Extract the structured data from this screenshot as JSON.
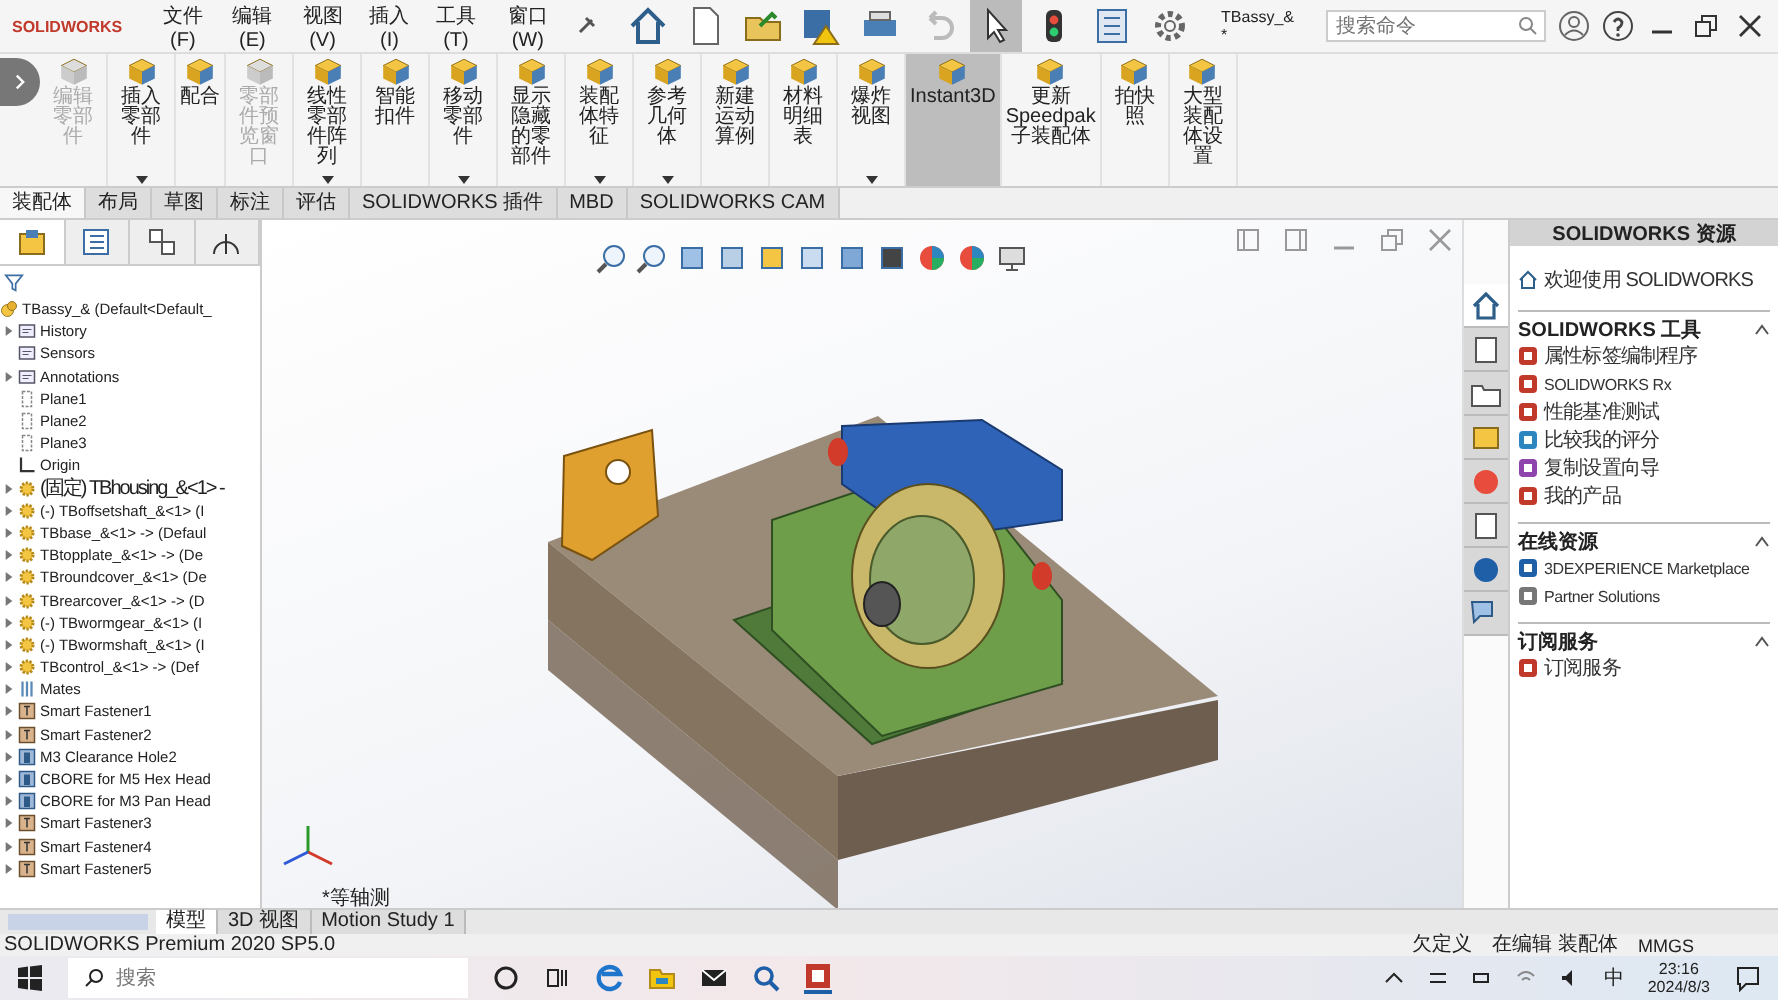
{
  "title_bar": {
    "logo": "SOLIDWORKS",
    "menus": [
      "文件(F)",
      "编辑(E)",
      "视图(V)",
      "插入(I)",
      "工具(T)",
      "窗口(W)"
    ],
    "document": "TBassy_& *",
    "search": {
      "placeholder": "搜索命令"
    }
  },
  "command_manager": {
    "buttons": [
      {
        "label": "编辑零部件",
        "disabled": true,
        "selected": false,
        "dropdown": false
      },
      {
        "label": "插入零部件",
        "disabled": false,
        "selected": false,
        "dropdown": true
      },
      {
        "label": "配合",
        "disabled": false,
        "selected": false,
        "dropdown": false
      },
      {
        "label": "零部件预览窗口",
        "disabled": true,
        "selected": false,
        "dropdown": false
      },
      {
        "label": "线性零部件阵列",
        "disabled": false,
        "selected": false,
        "dropdown": true
      },
      {
        "label": "智能扣件",
        "disabled": false,
        "selected": false,
        "dropdown": false
      },
      {
        "label": "移动零部件",
        "disabled": false,
        "selected": false,
        "dropdown": true
      },
      {
        "label": "显示隐藏的零部件",
        "disabled": false,
        "selected": false,
        "dropdown": false
      },
      {
        "label": "装配体特征",
        "disabled": false,
        "selected": false,
        "dropdown": true
      },
      {
        "label": "参考几何体",
        "disabled": false,
        "selected": false,
        "dropdown": true
      },
      {
        "label": "新建运动算例",
        "disabled": false,
        "selected": false,
        "dropdown": false
      },
      {
        "label": "材料明细表",
        "disabled": false,
        "selected": false,
        "dropdown": false
      },
      {
        "label": "爆炸视图",
        "disabled": false,
        "selected": false,
        "dropdown": true
      },
      {
        "label": "Instant3D",
        "disabled": false,
        "selected": true,
        "dropdown": false
      },
      {
        "label": "更新 Speedpak 子装配体",
        "disabled": false,
        "selected": false,
        "dropdown": false
      },
      {
        "label": "拍快照",
        "disabled": false,
        "selected": false,
        "dropdown": false
      },
      {
        "label": "大型装配体设置",
        "disabled": false,
        "selected": false,
        "dropdown": false
      }
    ]
  },
  "tabs": [
    {
      "label": "装配体",
      "selected": true
    },
    {
      "label": "布局",
      "selected": false
    },
    {
      "label": "草图",
      "selected": false
    },
    {
      "label": "标注",
      "selected": false
    },
    {
      "label": "评估",
      "selected": false
    },
    {
      "label": "SOLIDWORKS 插件",
      "selected": false
    },
    {
      "label": "MBD",
      "selected": false
    },
    {
      "label": "SOLIDWORKS CAM",
      "selected": false
    }
  ],
  "feature_tree": {
    "panel_tabs": [
      {
        "selected": true
      },
      {
        "selected": false
      },
      {
        "selected": false
      },
      {
        "selected": false
      }
    ],
    "root": "TBassy_&  (Default<Default_",
    "items": [
      {
        "label": "History",
        "kind": "folder",
        "expandable": true
      },
      {
        "label": "Sensors",
        "kind": "folder",
        "expandable": false
      },
      {
        "label": "Annotations",
        "kind": "folder",
        "expandable": true
      },
      {
        "label": "Plane1",
        "kind": "plane",
        "expandable": false
      },
      {
        "label": "Plane2",
        "kind": "plane",
        "expandable": false
      },
      {
        "label": "Plane3",
        "kind": "plane",
        "expandable": false
      },
      {
        "label": "Origin",
        "kind": "origin",
        "expandable": false
      },
      {
        "label": "(固定) TBhousing_&<1> -",
        "kind": "part",
        "expandable": true
      },
      {
        "label": "(-) TBoffsetshaft_&<1> (I",
        "kind": "part",
        "expandable": true
      },
      {
        "label": "TBbase_&<1> -> (Defaul",
        "kind": "part",
        "expandable": true
      },
      {
        "label": "TBtopplate_&<1> -> (De",
        "kind": "part",
        "expandable": true
      },
      {
        "label": "TBroundcover_&<1> (De",
        "kind": "part",
        "expandable": true
      },
      {
        "label": "TBrearcover_&<1> -> (D",
        "kind": "part",
        "expandable": true
      },
      {
        "label": "(-) TBwormgear_&<1> (I",
        "kind": "part",
        "expandable": true
      },
      {
        "label": "(-) TBwormshaft_&<1> (I",
        "kind": "part",
        "expandable": true
      },
      {
        "label": "TBcontrol_&<1> -> (Def",
        "kind": "part",
        "expandable": true
      },
      {
        "label": "Mates",
        "kind": "mates",
        "expandable": true
      },
      {
        "label": "Smart Fastener1",
        "kind": "fastener",
        "expandable": true
      },
      {
        "label": "Smart Fastener2",
        "kind": "fastener",
        "expandable": true
      },
      {
        "label": "M3 Clearance Hole2",
        "kind": "hole",
        "expandable": true
      },
      {
        "label": "CBORE for M5 Hex Head",
        "kind": "hole",
        "expandable": true
      },
      {
        "label": "CBORE for M3 Pan Head",
        "kind": "hole",
        "expandable": true
      },
      {
        "label": "Smart Fastener3",
        "kind": "fastener",
        "expandable": true
      },
      {
        "label": "Smart Fastener4",
        "kind": "fastener",
        "expandable": true
      },
      {
        "label": "Smart Fastener5",
        "kind": "fastener",
        "expandable": true
      }
    ]
  },
  "viewport": {
    "view_label": "*等轴测"
  },
  "task_pane": {
    "title": "SOLIDWORKS 资源",
    "side_tabs": [
      {
        "selected": true
      },
      {
        "selected": false
      },
      {
        "selected": false
      },
      {
        "selected": false
      },
      {
        "selected": false
      },
      {
        "selected": false
      },
      {
        "selected": false
      },
      {
        "selected": false
      }
    ],
    "welcome": "欢迎使用 SOLIDWORKS",
    "sections": [
      {
        "title": "SOLIDWORKS 工具",
        "expanded": true,
        "items": [
          "属性标签编制程序",
          "SOLIDWORKS Rx",
          "性能基准测试",
          "比较我的评分",
          "复制设置向导",
          "我的产品"
        ]
      },
      {
        "title": "在线资源",
        "expanded": true,
        "items": [
          "3DEXPERIENCE Marketplace",
          "Partner Solutions"
        ]
      },
      {
        "title": "订阅服务",
        "expanded": true,
        "items": [
          "订阅服务"
        ]
      }
    ]
  },
  "bottom_tabs": [
    {
      "label": "模型",
      "selected": true
    },
    {
      "label": "3D 视图",
      "selected": false
    },
    {
      "label": "Motion Study 1",
      "selected": false
    }
  ],
  "status_bar": {
    "product": "SOLIDWORKS Premium 2020 SP5.0",
    "state": "欠定义",
    "mode": "在编辑 装配体",
    "units": "MMGS"
  },
  "taskbar": {
    "search": {
      "placeholder": "搜索"
    },
    "ime": "中",
    "time": "23:16",
    "date": "2024/8/3"
  }
}
